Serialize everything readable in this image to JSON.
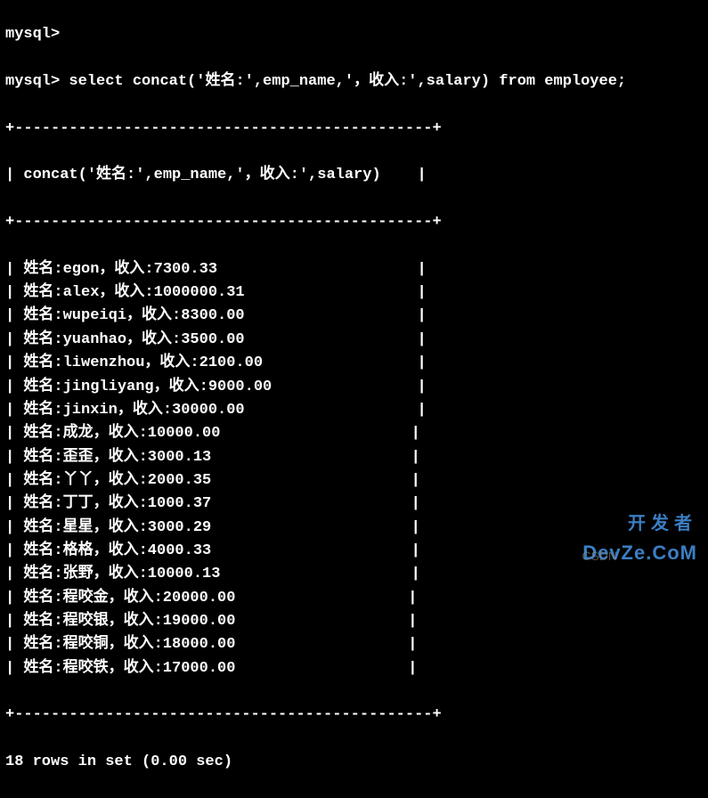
{
  "prompt_prefix_partial": "mysql>",
  "prompt_prefix": "mysql> ",
  "query": "select concat('姓名:',emp_name,'，收入:',salary) from employee;",
  "border_top": "+----------------------------------------------+",
  "header_line": "| concat('姓名:',emp_name,'，收入:',salary)    |",
  "rows": [
    "| 姓名:egon，收入:7300.33                      |",
    "| 姓名:alex，收入:1000000.31                   |",
    "| 姓名:wupeiqi，收入:8300.00                   |",
    "| 姓名:yuanhao，收入:3500.00                   |",
    "| 姓名:liwenzhou，收入:2100.00                 |",
    "| 姓名:jingliyang，收入:9000.00                |",
    "| 姓名:jinxin，收入:30000.00                   |",
    "| 姓名:成龙，收入:10000.00                     |",
    "| 姓名:歪歪，收入:3000.13                      |",
    "| 姓名:丫丫，收入:2000.35                      |",
    "| 姓名:丁丁，收入:1000.37                      |",
    "| 姓名:星星，收入:3000.29                      |",
    "| 姓名:格格，收入:4000.33                      |",
    "| 姓名:张野，收入:10000.13                     |",
    "| 姓名:程咬金，收入:20000.00                   |",
    "| 姓名:程咬银，收入:19000.00                   |",
    "| 姓名:程咬铜，收入:18000.00                   |",
    "| 姓名:程咬铁，收入:17000.00                   |"
  ],
  "footer": "18 rows in set (0.00 sec)",
  "watermark_top": "开发者",
  "watermark_mid": "DevZe.CoM",
  "watermark_under": "CSDN"
}
